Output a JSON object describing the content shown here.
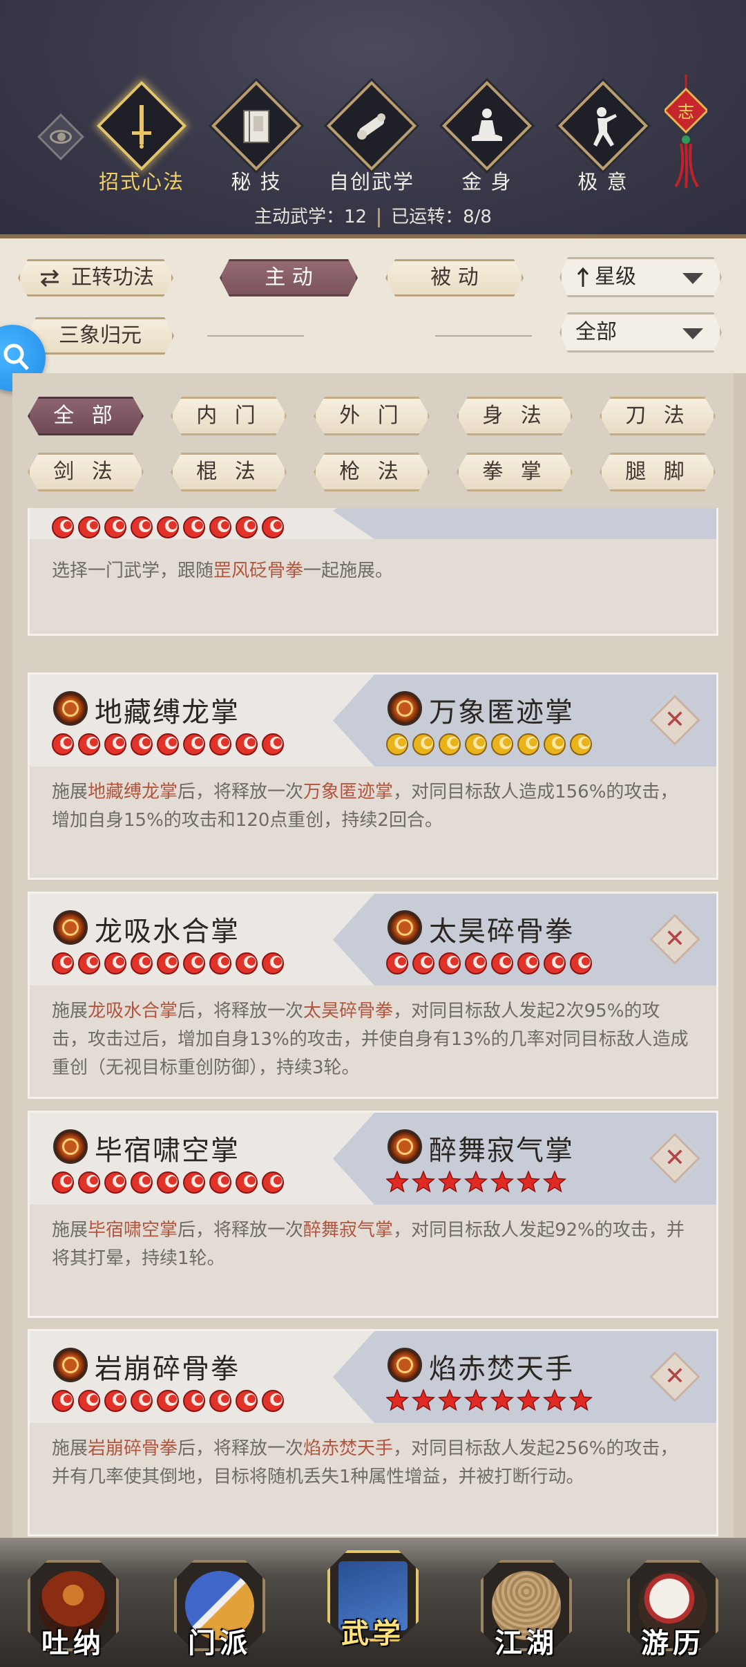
{
  "header": {
    "tabs": [
      {
        "label": "招式心法",
        "icon": "sword-icon",
        "active": true
      },
      {
        "label": "秘 技",
        "icon": "book-icon",
        "active": false
      },
      {
        "label": "自创武学",
        "icon": "scroll-icon",
        "active": false
      },
      {
        "label": "金 身",
        "icon": "meditation-icon",
        "active": false
      },
      {
        "label": "极 意",
        "icon": "martial-pose-icon",
        "active": false
      }
    ],
    "active_count_label": "主动武学：12",
    "running_label": "已运转：8/8",
    "knot_char": "志"
  },
  "filter": {
    "rotate_button": "正转功法",
    "mode_active": "主 动",
    "mode_passive": "被 动",
    "sort_label": "星级",
    "combo_button": "三象归元",
    "scope_label": "全部"
  },
  "categories": [
    "全 部",
    "内 门",
    "外 门",
    "身 法",
    "刀 法",
    "剑 法",
    "棍 法",
    "枪 法",
    "拳 掌",
    "腿 脚"
  ],
  "skills": [
    {
      "left_name": "",
      "right_name": "",
      "desc": [
        {
          "t": "选择一门武学，跟随",
          "hl": false
        },
        {
          "t": "罡风砭骨拳",
          "hl": true
        },
        {
          "t": "一起施展。",
          "hl": false
        }
      ]
    },
    {
      "left_name": "地藏缚龙掌",
      "right_name": "万象匿迹掌",
      "right_rating": "moon",
      "desc": [
        {
          "t": "施展",
          "hl": false
        },
        {
          "t": "地藏缚龙掌",
          "hl": true
        },
        {
          "t": "后，将释放一次",
          "hl": false
        },
        {
          "t": "万象匿迹掌",
          "hl": true
        },
        {
          "t": "，对同目标敌人造成156%的攻击，增加自身15%的攻击和120点重创，持续2回合。",
          "hl": false
        }
      ]
    },
    {
      "left_name": "龙吸水合掌",
      "right_name": "太昊碎骨拳",
      "right_rating": "fire",
      "desc": [
        {
          "t": "施展",
          "hl": false
        },
        {
          "t": "龙吸水合掌",
          "hl": true
        },
        {
          "t": "后，将释放一次",
          "hl": false
        },
        {
          "t": "太昊碎骨拳",
          "hl": true
        },
        {
          "t": "，对同目标敌人发起2次95%的攻击，攻击过后，增加自身13%的攻击，并使自身有13%的几率对同目标敌人造成重创（无视目标重创防御），持续3轮。",
          "hl": false
        }
      ]
    },
    {
      "left_name": "毕宿啸空掌",
      "right_name": "醉舞寂气掌",
      "right_rating": "star",
      "desc": [
        {
          "t": "施展",
          "hl": false
        },
        {
          "t": "毕宿啸空掌",
          "hl": true
        },
        {
          "t": "后，将释放一次",
          "hl": false
        },
        {
          "t": "醉舞寂气掌",
          "hl": true
        },
        {
          "t": "，对同目标敌人发起92%的攻击，并将其打晕，持续1轮。",
          "hl": false
        }
      ]
    },
    {
      "left_name": "岩崩碎骨拳",
      "right_name": "焰赤焚天手",
      "right_rating": "star",
      "desc": [
        {
          "t": "施展",
          "hl": false
        },
        {
          "t": "岩崩碎骨拳",
          "hl": true
        },
        {
          "t": "后，将释放一次",
          "hl": false
        },
        {
          "t": "焰赤焚天手",
          "hl": true
        },
        {
          "t": "，对同目标敌人发起256%的攻击，并有几率使其倒地，目标将随机丢失1种属性增益，并被打断行动。",
          "hl": false
        }
      ]
    }
  ],
  "bottom_nav": [
    {
      "label": "吐纳",
      "active": false
    },
    {
      "label": "门派",
      "active": false
    },
    {
      "label": "武学",
      "active": true,
      "badge": "武学"
    },
    {
      "label": "江湖",
      "active": false
    },
    {
      "label": "游历",
      "active": false
    }
  ],
  "colors": {
    "accent_gold": "#f2d162",
    "highlight_text": "#b2553f",
    "active_pill": "#7b545c"
  }
}
